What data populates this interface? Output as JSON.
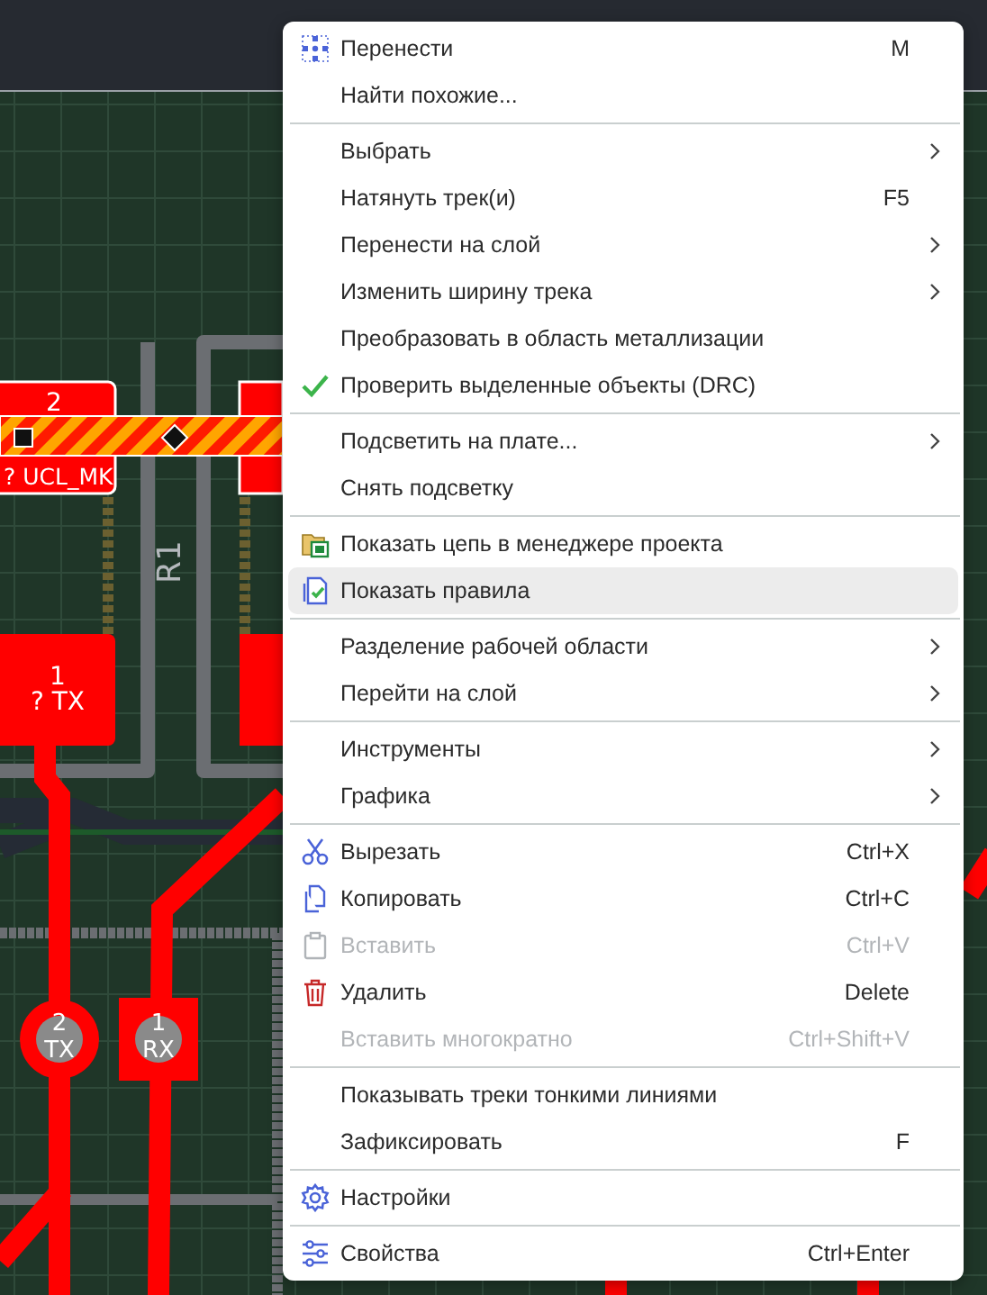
{
  "board": {
    "labels": [
      {
        "kind": "pad-number",
        "text": "2"
      },
      {
        "kind": "pad-net",
        "text": "? UCL_MK"
      },
      {
        "kind": "pad-number",
        "text": "1"
      },
      {
        "kind": "pad-net",
        "text": "? TX"
      },
      {
        "kind": "designator",
        "text": "R1"
      },
      {
        "kind": "via-number",
        "text": "2"
      },
      {
        "kind": "via-net",
        "text": "TX"
      },
      {
        "kind": "via-number",
        "text": "1"
      },
      {
        "kind": "via-net",
        "text": "RX"
      }
    ]
  },
  "menu": {
    "groups": [
      [
        {
          "label": "Перенести",
          "shortcut": "M",
          "submenu": false,
          "disabled": false,
          "selected": false
        },
        {
          "label": "Найти похожие...",
          "submenu": false,
          "disabled": false,
          "selected": false
        }
      ],
      [
        {
          "label": "Выбрать",
          "submenu": true,
          "disabled": false,
          "selected": false
        },
        {
          "label": "Натянуть трек(и)",
          "shortcut": "F5",
          "submenu": false,
          "disabled": false,
          "selected": false
        },
        {
          "label": "Перенести на слой",
          "submenu": true,
          "disabled": false,
          "selected": false
        },
        {
          "label": "Изменить ширину трека",
          "submenu": true,
          "disabled": false,
          "selected": false
        },
        {
          "label": "Преобразовать в область металлизации",
          "submenu": false,
          "disabled": false,
          "selected": false
        },
        {
          "label": "Проверить выделенные объекты (DRC)",
          "submenu": false,
          "disabled": false,
          "selected": false
        }
      ],
      [
        {
          "label": "Подсветить на плате...",
          "submenu": true,
          "disabled": false,
          "selected": false
        },
        {
          "label": "Снять подсветку",
          "submenu": false,
          "disabled": false,
          "selected": false
        }
      ],
      [
        {
          "label": "Показать цепь в менеджере проекта",
          "submenu": false,
          "disabled": false,
          "selected": false
        },
        {
          "label": "Показать правила",
          "submenu": false,
          "disabled": false,
          "selected": true
        }
      ],
      [
        {
          "label": "Разделение рабочей области",
          "submenu": true,
          "disabled": false,
          "selected": false
        },
        {
          "label": "Перейти на слой",
          "submenu": true,
          "disabled": false,
          "selected": false
        }
      ],
      [
        {
          "label": "Инструменты",
          "submenu": true,
          "disabled": false,
          "selected": false
        },
        {
          "label": "Графика",
          "submenu": true,
          "disabled": false,
          "selected": false
        }
      ],
      [
        {
          "label": "Вырезать",
          "shortcut": "Ctrl+X",
          "submenu": false,
          "disabled": false,
          "selected": false
        },
        {
          "label": "Копировать",
          "shortcut": "Ctrl+C",
          "submenu": false,
          "disabled": false,
          "selected": false
        },
        {
          "label": "Вставить",
          "shortcut": "Ctrl+V",
          "submenu": false,
          "disabled": true,
          "selected": false
        },
        {
          "label": "Удалить",
          "shortcut": "Delete",
          "submenu": false,
          "disabled": false,
          "selected": false
        },
        {
          "label": "Вставить многократно",
          "shortcut": "Ctrl+Shift+V",
          "submenu": false,
          "disabled": true,
          "selected": false
        }
      ],
      [
        {
          "label": "Показывать треки тонкими линиями",
          "submenu": false,
          "disabled": false,
          "selected": false
        },
        {
          "label": "Зафиксировать",
          "shortcut": "F",
          "submenu": false,
          "disabled": false,
          "selected": false
        }
      ],
      [
        {
          "label": "Настройки",
          "submenu": false,
          "disabled": false,
          "selected": false
        }
      ],
      [
        {
          "label": "Свойства",
          "shortcut": "Ctrl+Enter",
          "submenu": false,
          "disabled": false,
          "selected": false
        }
      ]
    ]
  }
}
